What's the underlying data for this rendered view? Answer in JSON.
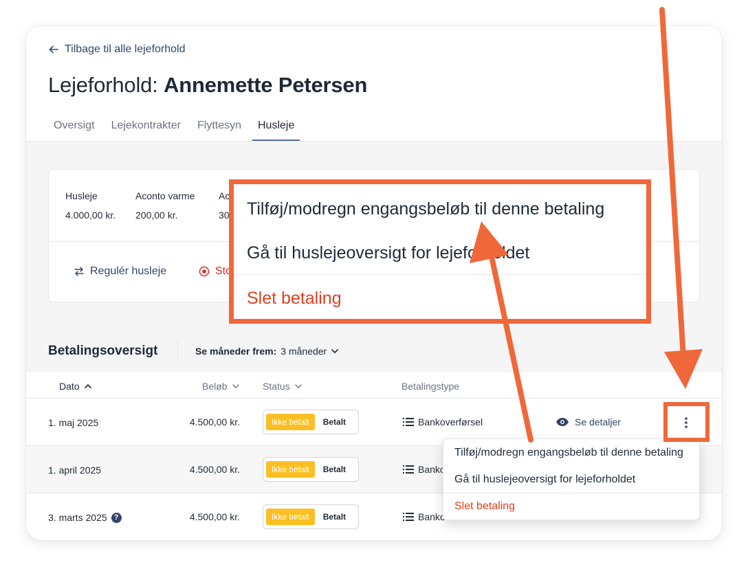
{
  "header": {
    "back_link": "Tilbage til alle lejeforhold",
    "title_prefix": "Lejeforhold:",
    "title_name": "Annemette Petersen"
  },
  "tabs": [
    {
      "label": "Oversigt"
    },
    {
      "label": "Lejekontrakter"
    },
    {
      "label": "Flyttesyn"
    },
    {
      "label": "Husleje",
      "active": true
    }
  ],
  "rent": {
    "cols": [
      {
        "label": "Husleje",
        "value": "4.000,00 kr."
      },
      {
        "label": "Aconto varme",
        "value": "200,00 kr."
      },
      {
        "label": "Ac",
        "value": "30"
      }
    ],
    "actions": {
      "regulate": "Regulér husleje",
      "stop": "Sto"
    }
  },
  "payments": {
    "title": "Betalingsoversigt",
    "months_label": "Se måneder frem:",
    "months_value": "3 måneder",
    "columns": {
      "date": "Dato",
      "amount": "Beløb",
      "status": "Status",
      "type": "Betalingstype"
    },
    "rows": [
      {
        "date": "1. maj 2025",
        "amount": "4.500,00 kr.",
        "unpaid": "Ikke betalt",
        "paid": "Betalt",
        "type": "Bankoverførsel",
        "details": "Se detaljer"
      },
      {
        "date": "1. april 2025",
        "amount": "4.500,00 kr.",
        "unpaid": "Ikke betalt",
        "paid": "Betalt",
        "type": "Banko"
      },
      {
        "date": "3. marts 2025",
        "amount": "4.500,00 kr.",
        "unpaid": "Ikke betalt",
        "paid": "Betalt",
        "type": "Banko",
        "help": "?"
      }
    ]
  },
  "menu": {
    "add_oneoff": "Tilføj/modregn engangsbeløb til denne betaling",
    "goto_overview": "Gå til huslejeoversigt for lejeforholdet",
    "delete": "Slet betaling"
  },
  "zoom_menu": {
    "add_oneoff": "Tilføj/modregn engangsbeløb til denne betaling",
    "goto_overview": "Gå til huslejeoversigt for lejeforholdet",
    "delete": "Slet betaling"
  },
  "colors": {
    "accent": "#334468",
    "annotation": "#f0683a",
    "danger": "#e0401f",
    "unpaid": "#fbbf24"
  }
}
